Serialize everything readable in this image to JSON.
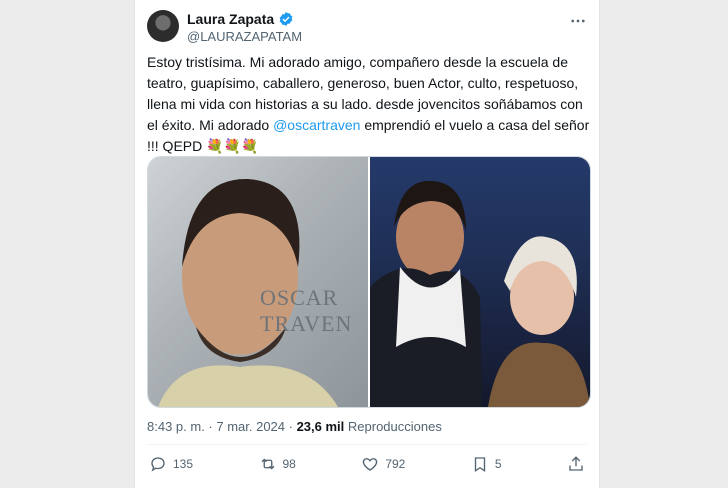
{
  "author": {
    "name": "Laura Zapata",
    "handle": "@LAURAZAPATAM"
  },
  "tweet": {
    "text_before": "Estoy tristísima. Mi adorado amigo, compañero desde la escuela de teatro, guapísimo, caballero, generoso, buen Actor, culto, respetuoso, llena mi vida con historias a su lado. desde jovencitos soñábamos con el éxito. Mi adorado ",
    "mention": "@oscartraven",
    "text_after": " emprendió el vuelo a casa del señor !!! QEPD 💐💐💐"
  },
  "media": {
    "book_line1": "OSCAR",
    "book_line2": "TRAVEN"
  },
  "meta": {
    "time": "8:43 p. m. · 7 mar. 2024 · ",
    "views_count": "23,6 mil",
    "views_label": " Reproducciones"
  },
  "actions": {
    "replies": "135",
    "reposts": "98",
    "likes": "792",
    "bookmarks": "5"
  },
  "colors": {
    "accent": "#1d9bf0",
    "text": "#0f1419",
    "muted": "#536471"
  },
  "icons": [
    "verified-icon",
    "more-icon",
    "reply-icon",
    "repost-icon",
    "like-icon",
    "bookmark-icon",
    "share-icon"
  ]
}
